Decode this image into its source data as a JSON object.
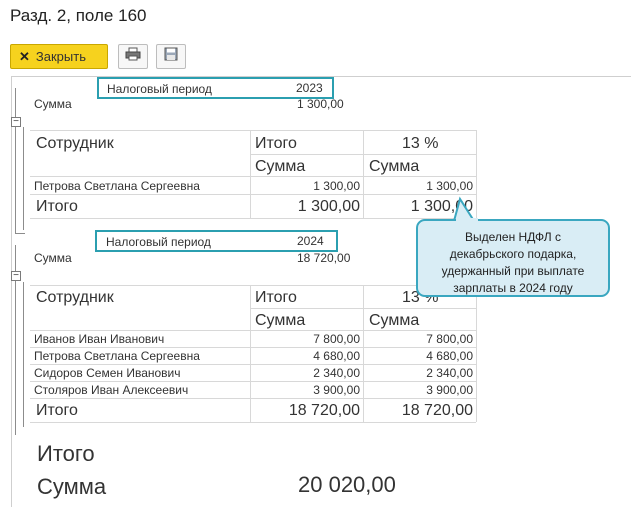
{
  "window": {
    "title": "Разд. 2, поле 160"
  },
  "toolbar": {
    "close_label": "Закрыть",
    "print_icon": "printer-icon",
    "save_icon": "floppy-disk-icon"
  },
  "groups": [
    {
      "period_label": "Налоговый период",
      "period_value": "2023",
      "sum_label": "Сумма",
      "sum_value": "1 300,00",
      "header": {
        "employee": "Сотрудник",
        "total": "Итого",
        "rate": "13 %",
        "sum1": "Сумма",
        "sum2": "Сумма"
      },
      "rows": [
        {
          "name": "Петрова Светлана Сергеевна",
          "total": "1 300,00",
          "rate": "1 300,00"
        }
      ],
      "footer": {
        "label": "Итого",
        "total": "1 300,00",
        "rate": "1 300,00"
      }
    },
    {
      "period_label": "Налоговый период",
      "period_value": "2024",
      "sum_label": "Сумма",
      "sum_value": "18 720,00",
      "header": {
        "employee": "Сотрудник",
        "total": "Итого",
        "rate": "13 %",
        "sum1": "Сумма",
        "sum2": "Сумма"
      },
      "rows": [
        {
          "name": "Иванов Иван Иванович",
          "total": "7 800,00",
          "rate": "7 800,00"
        },
        {
          "name": "Петрова Светлана Сергеевна",
          "total": "4 680,00",
          "rate": "4 680,00"
        },
        {
          "name": "Сидоров Семен Иванович",
          "total": "2 340,00",
          "rate": "2 340,00"
        },
        {
          "name": "Столяров Иван Алексеевич",
          "total": "3 900,00",
          "rate": "3 900,00"
        }
      ],
      "footer": {
        "label": "Итого",
        "total": "18 720,00",
        "rate": "18 720,00"
      }
    }
  ],
  "grand_total": {
    "label": "Итого",
    "sum_label": "Сумма",
    "sum_value": "20 020,00"
  },
  "callout": {
    "line1": "Выделен НДФЛ с",
    "line2": "декабрьского подарка,",
    "line3": "удержанный при выплате",
    "line4": "зарплаты в 2024 году"
  },
  "colors": {
    "close_button": "#f6d21e",
    "highlight_box": "#2b9fb0",
    "callout_fill": "#d9edf5"
  }
}
